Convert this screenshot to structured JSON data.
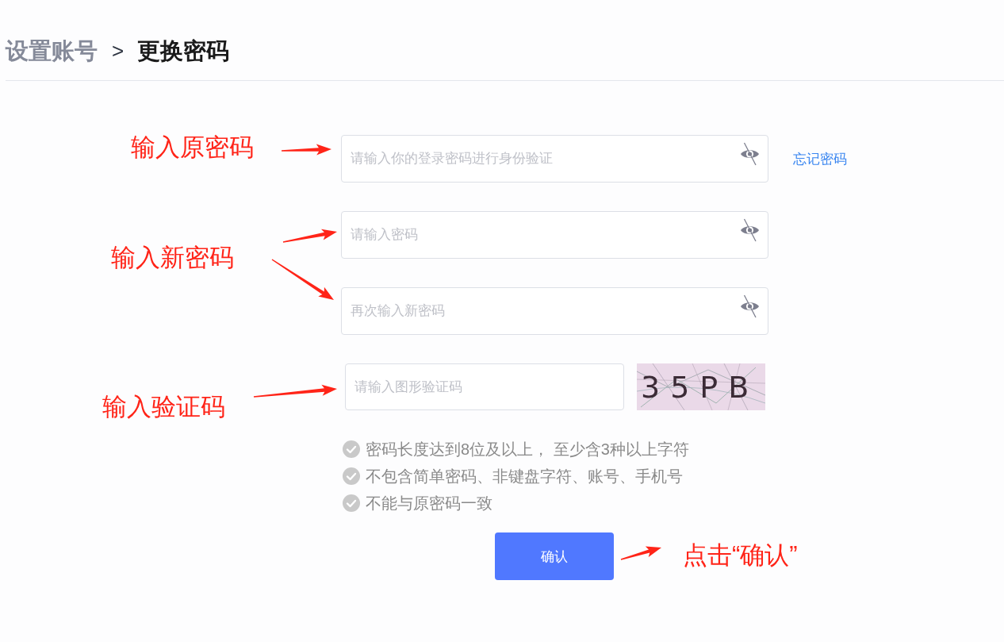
{
  "breadcrumb": {
    "parent": "设置账号",
    "separator": ">",
    "current": "更换密码"
  },
  "form": {
    "fields": [
      {
        "kind": "password",
        "placeholder": "请输入你的登录密码进行身份验证",
        "revealed": false,
        "link": "忘记密码"
      },
      {
        "kind": "password",
        "placeholder": "请输入密码",
        "revealed": false
      },
      {
        "kind": "password",
        "placeholder": "再次输入新密码",
        "revealed": false
      },
      {
        "kind": "captcha",
        "placeholder": "请输入图形验证码",
        "captcha_code": "35PB"
      }
    ],
    "rules": [
      {
        "text": "密码长度达到8位及以上， 至少含3种以上字符",
        "met": false
      },
      {
        "text": "不包含简单密码、非键盘字符、账号、手机号",
        "met": false
      },
      {
        "text": "不能与原密码一致",
        "met": false
      }
    ],
    "submit_button": "确认"
  },
  "annotations": [
    {
      "text": "输入原密码"
    },
    {
      "text": "输入新密码"
    },
    {
      "text": "输入验证码"
    },
    {
      "text": "点击“确认”"
    }
  ]
}
